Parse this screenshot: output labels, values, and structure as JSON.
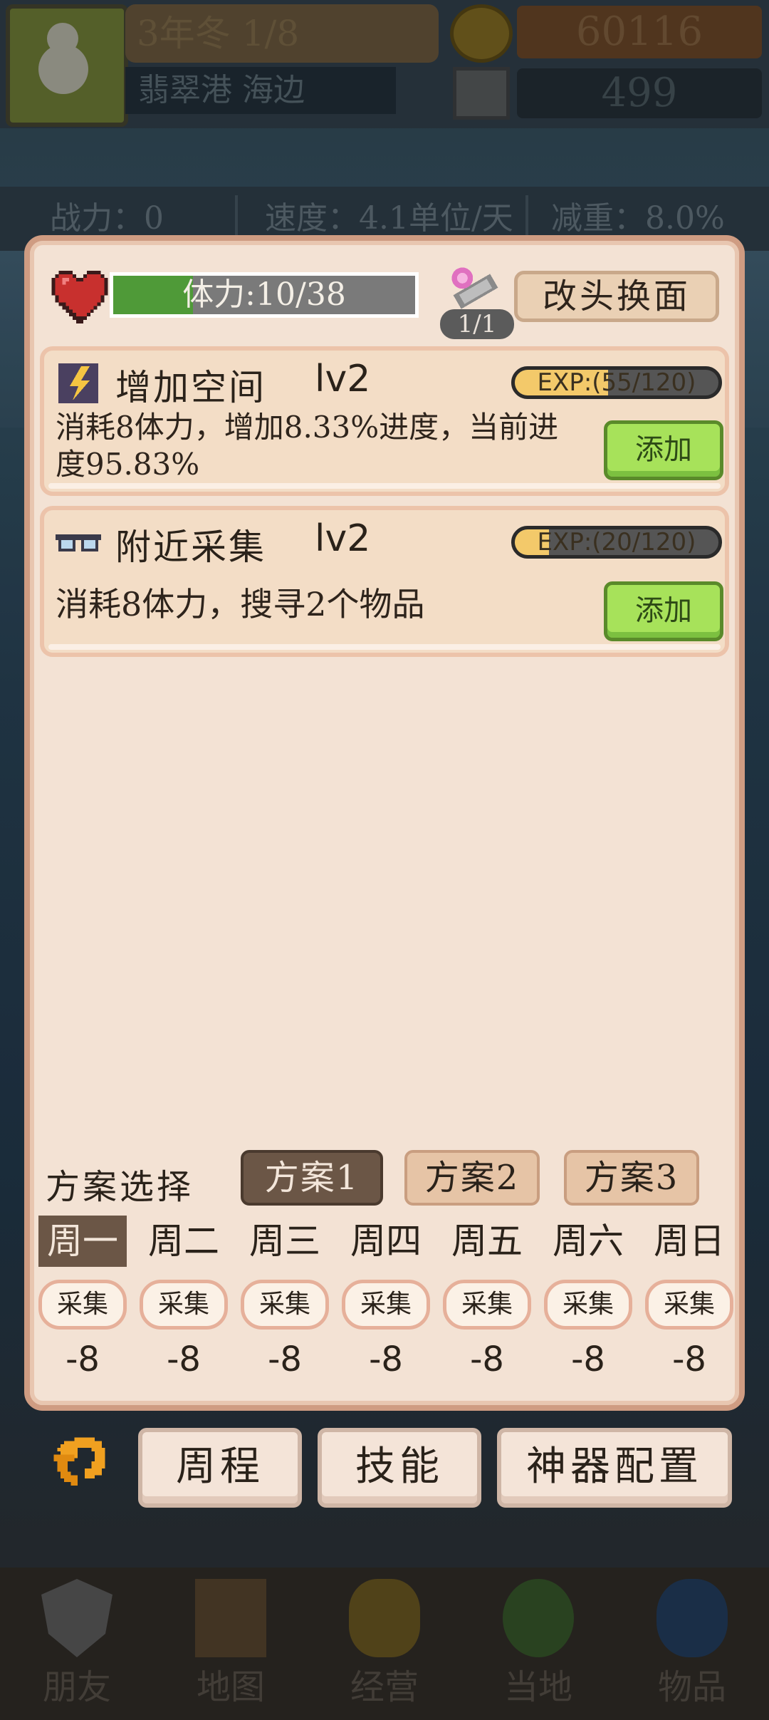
{
  "hud": {
    "date": "3年冬 1/8",
    "location": "翡翠港 海边",
    "gold": "60116",
    "gems": "499",
    "stats": {
      "power": "战力：0",
      "speed": "速度：4.1单位/天",
      "weight_reduction": "减重：8.0%"
    }
  },
  "panel": {
    "stamina": {
      "text": "体力:10/38",
      "current": 10,
      "max": 38
    },
    "scroll_count": "1/1",
    "change_face_label": "改头换面",
    "skills": [
      {
        "icon": "lightning-icon",
        "name": "增加空间",
        "level": "lv2",
        "exp_text": "EXP:(55/120)",
        "exp": 55,
        "exp_max": 120,
        "description": "消耗8体力，增加8.33%进度，当前进度95.83%",
        "button_label": "添加"
      },
      {
        "icon": "glasses-icon",
        "name": "附近采集",
        "level": "lv2",
        "exp_text": "EXP:(20/120)",
        "exp": 20,
        "exp_max": 120,
        "description": "消耗8体力，搜寻2个物品",
        "button_label": "添加"
      }
    ],
    "plan_label": "方案选择",
    "plans": [
      "方案1",
      "方案2",
      "方案3"
    ],
    "active_plan": 0,
    "days": [
      "周一",
      "周二",
      "周三",
      "周四",
      "周五",
      "周六",
      "周日"
    ],
    "active_day": 0,
    "slots": [
      "采集",
      "采集",
      "采集",
      "采集",
      "采集",
      "采集",
      "采集"
    ],
    "costs": [
      "-8",
      "-8",
      "-8",
      "-8",
      "-8",
      "-8",
      "-8"
    ]
  },
  "actions": {
    "schedule": "周程",
    "skills": "技能",
    "artifact": "神器配置"
  },
  "nav": [
    "朋友",
    "地图",
    "经营",
    "当地",
    "物品"
  ],
  "colors": {
    "panel_bg": "#f3e2d4",
    "stamina_fill": "#4f9a38",
    "add_button": "#a7e25a",
    "active_tab": "#6b5646",
    "exp_fill": "#f3c96a"
  }
}
